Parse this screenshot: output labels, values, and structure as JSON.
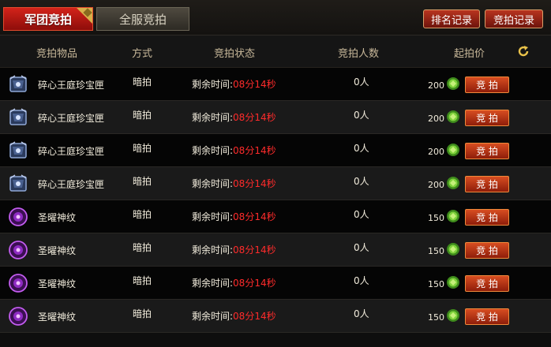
{
  "tabs": [
    {
      "label": "军团竞拍",
      "active": true
    },
    {
      "label": "全服竞拍",
      "active": false
    }
  ],
  "top_buttons": {
    "rank": "排名记录",
    "record": "竞拍记录"
  },
  "columns": {
    "item": "竞拍物品",
    "method": "方式",
    "status": "竞拍状态",
    "count": "竞拍人数",
    "price": "起拍价"
  },
  "rows": [
    {
      "icon": "treasure-box-icon",
      "name": "碎心王庭珍宝匣",
      "method": "暗拍",
      "status_label": "剩余时间:",
      "time": "08分14秒",
      "count": "0人",
      "price": "200",
      "bid_label": "竞 拍"
    },
    {
      "icon": "treasure-box-icon",
      "name": "碎心王庭珍宝匣",
      "method": "暗拍",
      "status_label": "剩余时间:",
      "time": "08分14秒",
      "count": "0人",
      "price": "200",
      "bid_label": "竞 拍"
    },
    {
      "icon": "treasure-box-icon",
      "name": "碎心王庭珍宝匣",
      "method": "暗拍",
      "status_label": "剩余时间:",
      "time": "08分14秒",
      "count": "0人",
      "price": "200",
      "bid_label": "竞 拍"
    },
    {
      "icon": "treasure-box-icon",
      "name": "碎心王庭珍宝匣",
      "method": "暗拍",
      "status_label": "剩余时间:",
      "time": "08分14秒",
      "count": "0人",
      "price": "200",
      "bid_label": "竞 拍"
    },
    {
      "icon": "rune-orb-icon",
      "name": "圣曜神纹",
      "method": "暗拍",
      "status_label": "剩余时间:",
      "time": "08分14秒",
      "count": "0人",
      "price": "150",
      "bid_label": "竞 拍"
    },
    {
      "icon": "rune-orb-icon",
      "name": "圣曜神纹",
      "method": "暗拍",
      "status_label": "剩余时间:",
      "time": "08分14秒",
      "count": "0人",
      "price": "150",
      "bid_label": "竞 拍"
    },
    {
      "icon": "rune-orb-icon",
      "name": "圣曜神纹",
      "method": "暗拍",
      "status_label": "剩余时间:",
      "time": "08分14秒",
      "count": "0人",
      "price": "150",
      "bid_label": "竞 拍"
    },
    {
      "icon": "rune-orb-icon",
      "name": "圣曜神纹",
      "method": "暗拍",
      "status_label": "剩余时间:",
      "time": "08分14秒",
      "count": "0人",
      "price": "150",
      "bid_label": "竞 拍"
    }
  ],
  "colors": {
    "accent": "#d3231a",
    "timer": "#ff2b2b",
    "button": "#c53a16"
  }
}
